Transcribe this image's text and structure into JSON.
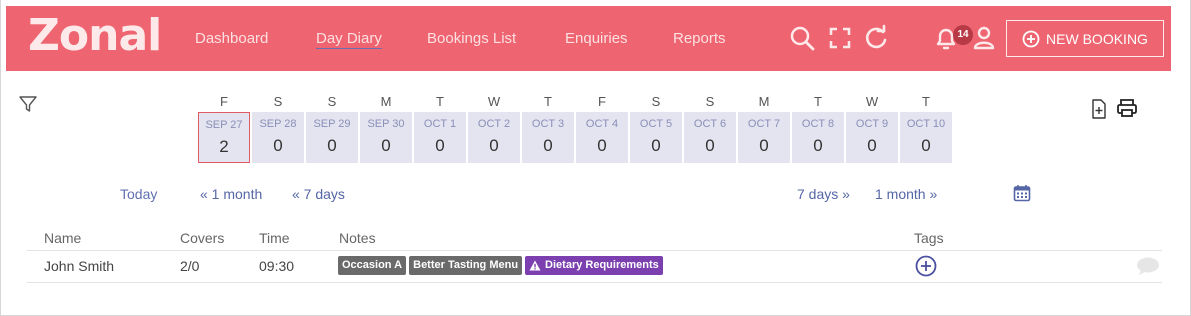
{
  "header": {
    "logo": "Zonal",
    "nav": [
      "Dashboard",
      "Day Diary",
      "Bookings List",
      "Enquiries",
      "Reports"
    ],
    "active_nav": "Day Diary",
    "notification_count": "14",
    "new_booking_label": "NEW BOOKING",
    "icons": [
      "search-icon",
      "fullscreen-icon",
      "refresh-icon",
      "bell-icon",
      "user-icon",
      "plus-circle-icon"
    ]
  },
  "days": [
    {
      "dow": "F",
      "date": "SEP 27",
      "count": "2",
      "selected": true
    },
    {
      "dow": "S",
      "date": "SEP 28",
      "count": "0"
    },
    {
      "dow": "S",
      "date": "SEP 29",
      "count": "0"
    },
    {
      "dow": "M",
      "date": "SEP 30",
      "count": "0"
    },
    {
      "dow": "T",
      "date": "OCT 1",
      "count": "0"
    },
    {
      "dow": "W",
      "date": "OCT 2",
      "count": "0"
    },
    {
      "dow": "T",
      "date": "OCT 3",
      "count": "0"
    },
    {
      "dow": "F",
      "date": "OCT 4",
      "count": "0"
    },
    {
      "dow": "S",
      "date": "OCT 5",
      "count": "0"
    },
    {
      "dow": "S",
      "date": "OCT 6",
      "count": "0"
    },
    {
      "dow": "M",
      "date": "OCT 7",
      "count": "0"
    },
    {
      "dow": "T",
      "date": "OCT 8",
      "count": "0"
    },
    {
      "dow": "W",
      "date": "OCT 9",
      "count": "0"
    },
    {
      "dow": "T",
      "date": "OCT 10",
      "count": "0"
    }
  ],
  "date_nav": {
    "today": "Today",
    "back_month": "« 1 month",
    "back_week": "« 7 days",
    "fwd_week": "7 days »",
    "fwd_month": "1 month »"
  },
  "table": {
    "headers": {
      "name": "Name",
      "covers": "Covers",
      "time": "Time",
      "notes": "Notes",
      "tags": "Tags"
    },
    "rows": [
      {
        "name": "John Smith",
        "covers": "2/0",
        "time": "09:30",
        "notes": [
          "Occasion A",
          "Better Tasting Menu",
          "Dietary Requirements"
        ]
      }
    ]
  },
  "colors": {
    "header_bg": "#ee6470",
    "selected_border": "#e05a66",
    "day_box": "#e4e4f0",
    "link": "#5566a6",
    "tag_grey": "#6a6a6a",
    "tag_purple": "#7b3fb0"
  }
}
